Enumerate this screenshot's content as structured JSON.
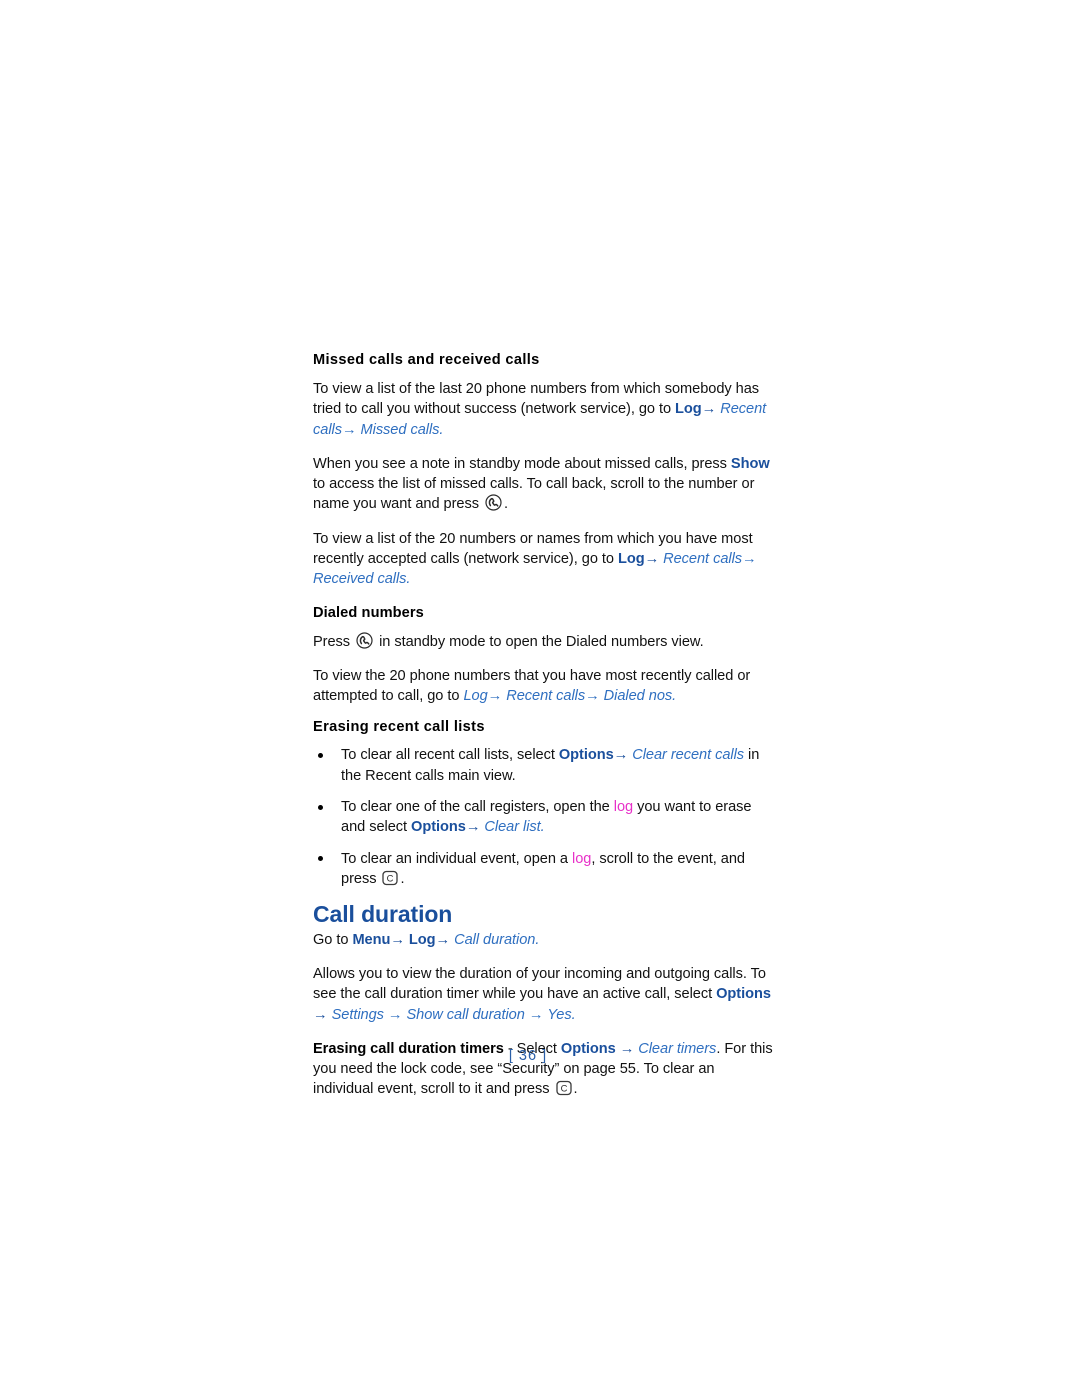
{
  "document": {
    "page_number": "[ 36 ]",
    "colors": {
      "body_text": "#111111",
      "ui_bold_blue": "#1a4f9c",
      "path_italic_blue": "#2f6fc0",
      "cross_reference_magenta": "#e831c8",
      "heading_blue": "#1a4f9c",
      "page_background": "#ffffff"
    }
  },
  "sections": {
    "missed_received": {
      "heading": "Missed calls and received calls",
      "para1": {
        "t1": "To view a list of the last 20 phone numbers from which somebody has tried to call you without success (network service), go to ",
        "ui1": "Log",
        "arrow1": "→ ",
        "path1": "Recent calls",
        "arrow2": "→ ",
        "path2": "Missed calls",
        "t2": "."
      },
      "para2": {
        "t1": "When you see a note in standby mode about missed calls, press ",
        "ui1": "Show",
        "t2": " to access the list of missed calls. To call back, scroll to the number or name you want and press ",
        "icon": "call-key-icon",
        "t3": "."
      },
      "para3": {
        "t1": "To view a list of the 20 numbers or names from which you have most recently accepted calls (network service), go to ",
        "ui1": "Log",
        "arrow1": "→ ",
        "path1": "Recent calls",
        "arrow2": "→ ",
        "path2": "Received calls",
        "t2": "."
      }
    },
    "dialed_numbers": {
      "heading": "Dialed numbers",
      "para1": {
        "t1": "Press ",
        "icon": "call-key-icon",
        "t2": " in standby mode to open the Dialed numbers view."
      },
      "para2": {
        "t1": "To view the 20 phone numbers that you have most recently called or attempted to call, go to ",
        "path1": "Log",
        "arrow1": "→ ",
        "path2": "Recent calls",
        "arrow2": "→ ",
        "path3": "Dialed nos",
        "t2": "."
      }
    },
    "erasing_lists": {
      "heading": "Erasing recent call lists",
      "bullets": [
        {
          "t1": "To clear all recent call lists, select ",
          "ui1": "Options",
          "arrow1": "→ ",
          "path1": "Clear recent calls",
          "t2": " in the Recent calls main view."
        },
        {
          "t1": "To clear one of the call registers, open the ",
          "mag1": "log",
          "t2": " you want to erase and select ",
          "ui1": "Options",
          "arrow1": "→ ",
          "path1": "Clear list",
          "t3": "."
        },
        {
          "t1": "To clear an individual event, open a ",
          "mag1": "log",
          "t2": ", scroll to the event, and press ",
          "icon": "clear-key-icon",
          "t3": "."
        }
      ]
    },
    "call_duration": {
      "heading": "Call duration",
      "goto": {
        "t1": "Go to ",
        "ui1": "Menu",
        "arrow1": "→ ",
        "ui2": "Log",
        "arrow2": "→ ",
        "path1": "Call duration",
        "t2": "."
      },
      "para1": {
        "t1": "Allows you to view the duration of your incoming and outgoing calls. To see the call duration timer while you have an active call, select ",
        "ui1": "Options",
        "arrow1": " → ",
        "path1": "Settings",
        "arrow2": " → ",
        "path2": "Show call duration",
        "arrow3": " → ",
        "path3": "Yes",
        "t2": "."
      },
      "para2": {
        "bold1": "Erasing call duration timers",
        "t1": " - Select ",
        "ui1": "Options",
        "arrow1": " → ",
        "path1": "Clear timers",
        "t2": ". For this you need the lock code, see “Security” on page 55. To clear an individual event, scroll to it and press ",
        "icon": "clear-key-icon",
        "t3": "."
      }
    }
  }
}
